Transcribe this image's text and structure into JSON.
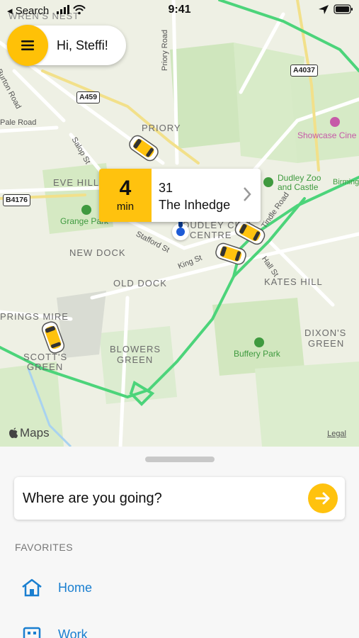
{
  "status_bar": {
    "back_label": "◂ Search",
    "time": "9:41"
  },
  "greeting": {
    "text": "Hi, Steffi!"
  },
  "eta": {
    "minutes": "4",
    "unit": "min",
    "address_line1": "31",
    "address_line2": "The Inhedge"
  },
  "map": {
    "area_labels": [
      {
        "text": "WREN'S NEST"
      },
      {
        "text": "PRIORY"
      },
      {
        "text": "EVE HILL"
      },
      {
        "text": "NEW DOCK"
      },
      {
        "text": "OLD DOCK"
      },
      {
        "text": "DUDLEY CITY"
      },
      {
        "text": "CENTRE"
      },
      {
        "text": "KATES HILL"
      },
      {
        "text": "DIXON'S"
      },
      {
        "text": "GREEN"
      },
      {
        "text": "BLOWERS"
      },
      {
        "text": "GREEN"
      },
      {
        "text": "PRINGS MIRE"
      },
      {
        "text": "SCOTT'S"
      },
      {
        "text": "GREEN"
      }
    ],
    "road_labels": [
      "Burton Road",
      "Pale Road",
      "Priory Road",
      "Salop St",
      "Stafford St",
      "King St",
      "Hall St",
      "Tindle Road",
      "Birming"
    ],
    "poi_labels": {
      "showcase": "Showcase Cine",
      "zoo": "Dudley Zoo and Castle",
      "zoo_line1": "Dudley Zoo",
      "zoo_line2": "and Castle",
      "grange": "Grange Park",
      "buffery": "Buffery Park"
    },
    "shields": [
      "A459",
      "A4037",
      "B4176"
    ],
    "attribution": "Maps",
    "legal": "Legal"
  },
  "sheet": {
    "search_placeholder": "Where are you going?",
    "favorites_heading": "FAVORITES",
    "favorites": [
      {
        "label": "Home",
        "icon": "home-icon"
      },
      {
        "label": "Work",
        "icon": "work-icon"
      }
    ]
  },
  "colors": {
    "accent_yellow": "#ffc20e",
    "link_blue": "#1a7fd0",
    "route_green": "#4cd47a"
  }
}
